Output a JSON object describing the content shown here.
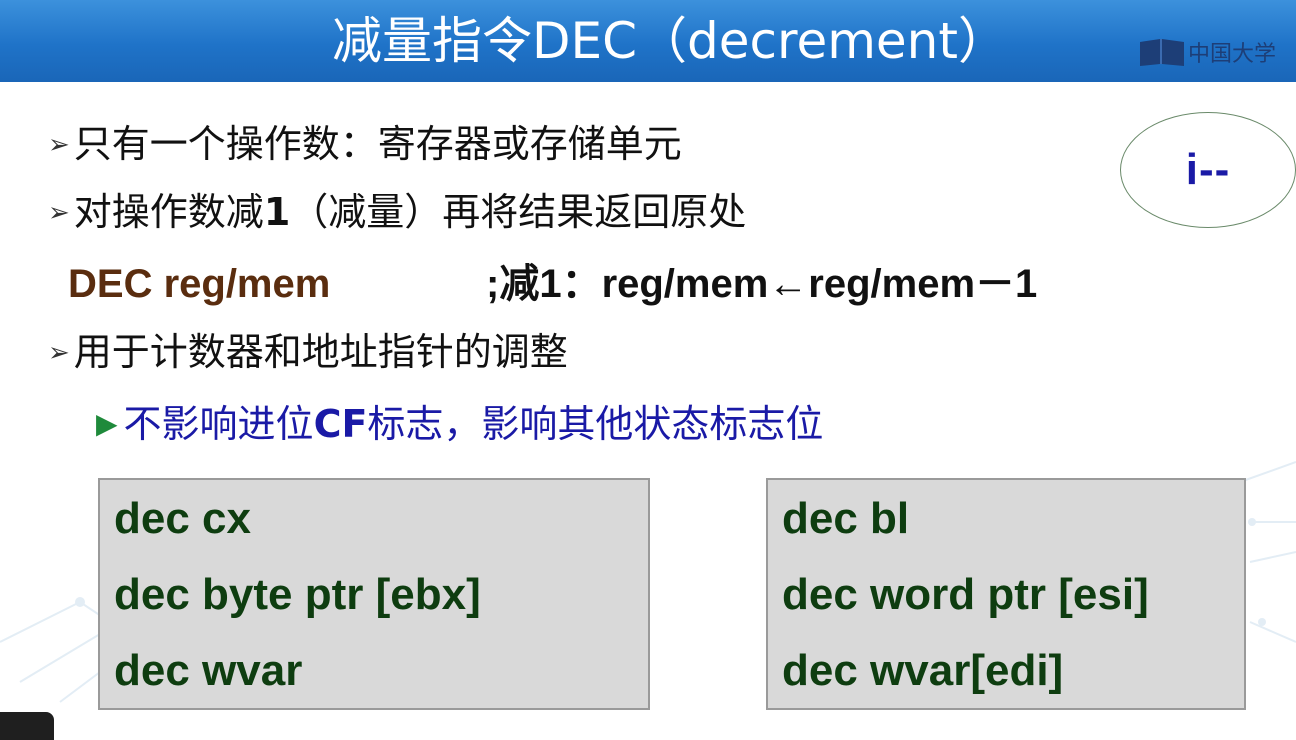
{
  "slide": {
    "title": "减量指令DEC（decrement）",
    "logo_text": "中国大学",
    "bullets": {
      "b1": "只有一个操作数：寄存器或存储单元",
      "b2_pre": "对操作数减",
      "b2_num": "1",
      "b2_post": "（减量）再将结果返回原处",
      "b3": "用于计数器和地址指针的调整"
    },
    "syntax": {
      "left": "DEC reg/mem",
      "right": ";减1：reg/mem←reg/mem－1"
    },
    "sub_bullet": {
      "pre": "不影响进位",
      "cf": "CF",
      "post": "标志，影响其他状态标志位"
    },
    "ellipse_label": "i--",
    "code_left": [
      "dec cx",
      "dec byte ptr [ebx]",
      "dec wvar"
    ],
    "code_right": [
      "dec bl",
      "dec word ptr [esi]",
      "dec wvar[edi]"
    ]
  },
  "icons": {
    "bullet": "arrowhead-icon",
    "sub_bullet": "green-triangle-icon",
    "logo": "book-logo-icon"
  },
  "colors": {
    "header": "#1f73c8",
    "syntax_keyword": "#5a2d0f",
    "sub_bullet_text": "#1a1aa6",
    "code_text": "#0e3d10",
    "code_box_bg": "#d9d9d9"
  }
}
